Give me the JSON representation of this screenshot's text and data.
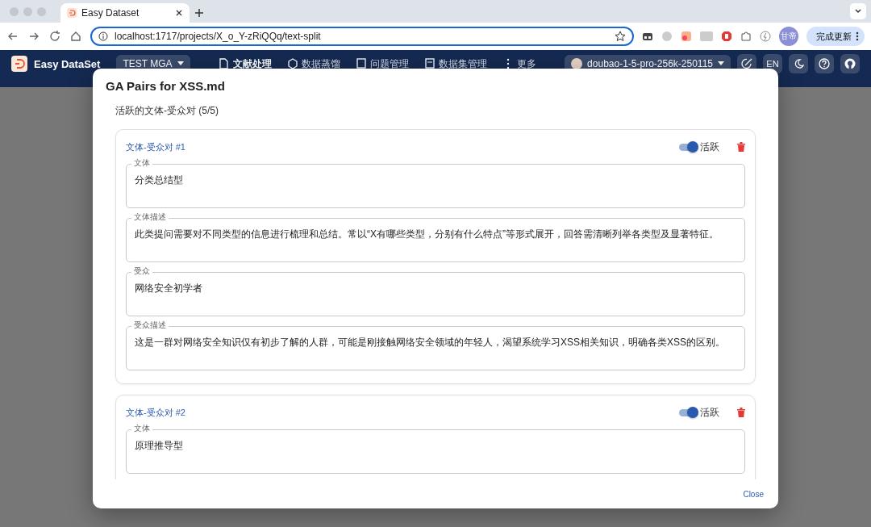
{
  "browser": {
    "tabs": [
      {
        "title": "Easy Dataset",
        "selected": true
      }
    ],
    "url": "localhost:1717/projects/X_o_Y-zRiQQq/text-split",
    "profile": "甘帝",
    "update_button": "完成更新"
  },
  "app_bar": {
    "brand": "Easy DataSet",
    "project": "TEST MGA",
    "nav": [
      {
        "label": "文献处理",
        "selected": true
      },
      {
        "label": "数据蒸馏",
        "selected": false
      },
      {
        "label": "问题管理",
        "selected": false
      },
      {
        "label": "数据集管理",
        "selected": false
      },
      {
        "label": "更多",
        "selected": false
      }
    ],
    "model": "doubao-1-5-pro-256k-250115",
    "language": "EN"
  },
  "dialog": {
    "title": "GA Pairs for XSS.md",
    "subtitle": "活跃的文体-受众对 (5/5)",
    "pairs": [
      {
        "title": "文体-受众对 #1",
        "active": true,
        "active_label": "活跃",
        "fields": [
          {
            "label": "文体",
            "value": "分类总结型"
          },
          {
            "label": "文体描述",
            "value": "此类提问需要对不同类型的信息进行梳理和总结。常以“X有哪些类型，分别有什么特点”等形式展开，回答需清晰列举各类型及显著特征。"
          },
          {
            "label": "受众",
            "value": "网络安全初学者"
          },
          {
            "label": "受众描述",
            "value": "这是一群对网络安全知识仅有初步了解的人群，可能是刚接触网络安全领域的年轻人，渴望系统学习XSS相关知识，明确各类XSS的区别。"
          }
        ]
      },
      {
        "title": "文体-受众对 #2",
        "active": true,
        "active_label": "活跃",
        "fields": [
          {
            "label": "文体",
            "value": "原理推导型"
          }
        ]
      }
    ],
    "close_button": "Close"
  }
}
